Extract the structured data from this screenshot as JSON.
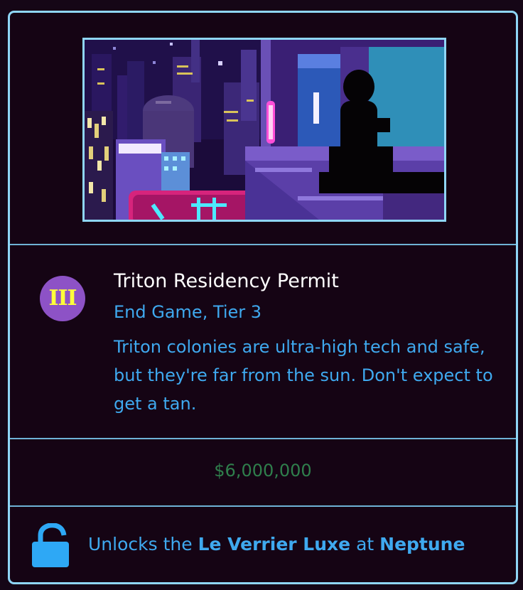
{
  "item": {
    "badge": "III",
    "title": "Triton Residency Permit",
    "tier": "End Game, Tier 3",
    "description": "Triton colonies are ultra-high tech and safe, but they're far from the sun. Don't expect to get a tan.",
    "price": "$6,000,000"
  },
  "unlock": {
    "prefix": "Unlocks the ",
    "ship": "Le Verrier Luxe",
    "middle": " at ",
    "location": "Neptune",
    "icon": "unlocked-padlock-icon"
  },
  "colors": {
    "border": "#8fd6f7",
    "background": "#150414",
    "accent": "#3fa9ef",
    "price": "#2f7f4c",
    "badge": "#8d52c6",
    "badge_text": "#ffff3a"
  }
}
